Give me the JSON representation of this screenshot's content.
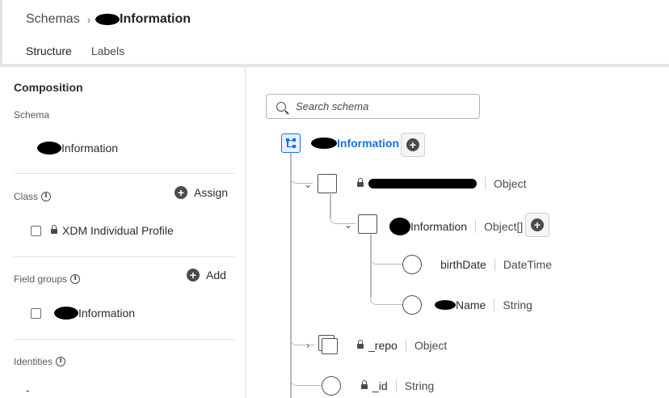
{
  "breadcrumb": {
    "root": "Schemas",
    "current_suffix": "Information"
  },
  "tabs": [
    {
      "label": "Structure"
    },
    {
      "label": "Labels"
    }
  ],
  "composition": {
    "title": "Composition",
    "schema_label": "Schema",
    "schema_name_suffix": "Information",
    "class_label": "Class",
    "assign_label": "Assign",
    "class_item": "XDM Individual Profile",
    "field_groups_label": "Field groups",
    "add_label": "Add",
    "field_group_item_suffix": "Information",
    "identities_label": "Identities",
    "identities_value": "-"
  },
  "search": {
    "placeholder": "Search schema"
  },
  "tree": {
    "root_suffix": "Information",
    "node1_type": "Object",
    "node2_name_suffix": "Information",
    "node2_type": "Object[]",
    "node3_name": "birthDate",
    "node3_type": "DateTime",
    "node4_name_suffix": "Name",
    "node4_type": "String",
    "node5_name": "_repo",
    "node5_type": "Object",
    "node6_name": "_id",
    "node6_type": "String"
  },
  "colors": {
    "accent": "#1473e6",
    "text": "#2c2c2c"
  }
}
